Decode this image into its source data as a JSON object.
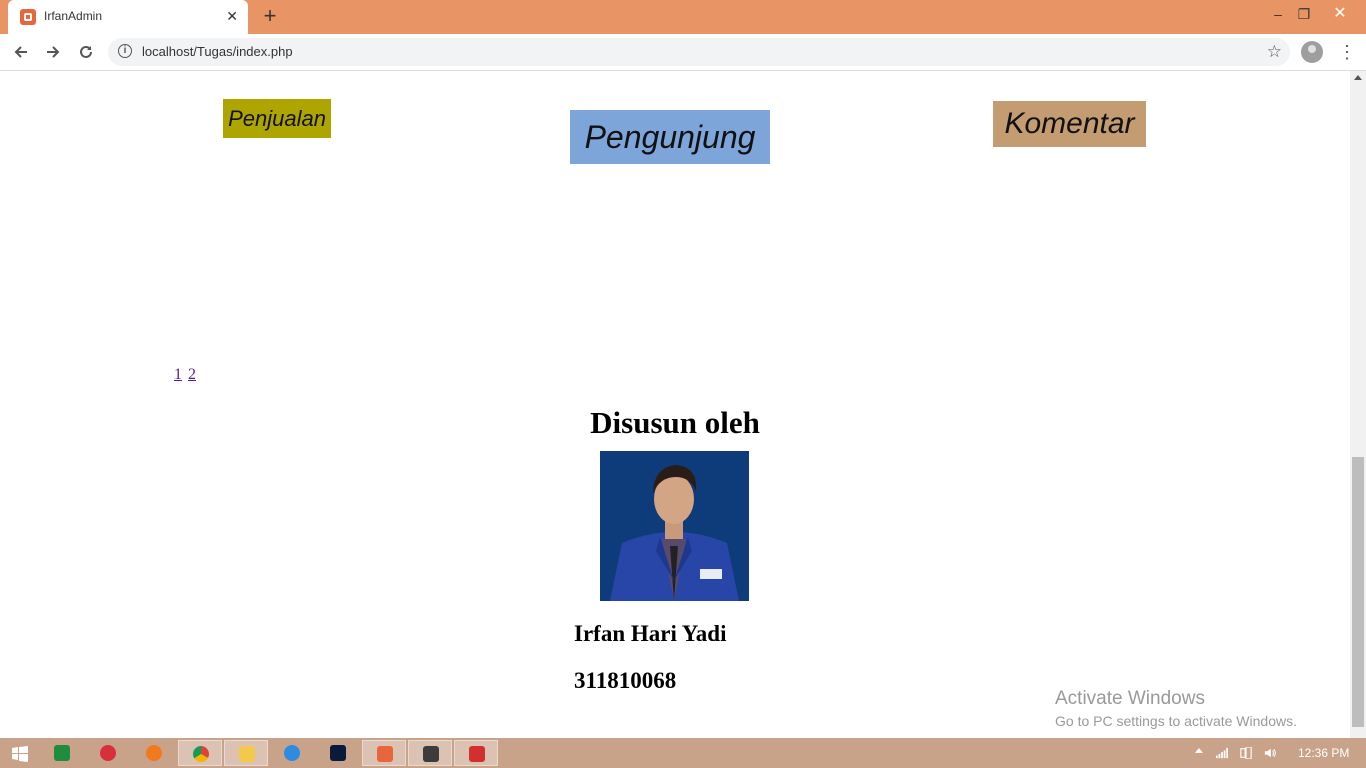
{
  "browser": {
    "tab_title": "IrfanAdmin",
    "url": "localhost/Tugas/index.php",
    "new_tab_symbol": "+",
    "close_tab_symbol": "✕"
  },
  "window_controls": {
    "minimize": "–",
    "maximize": "❐",
    "close": "✕"
  },
  "stats": {
    "penjualan": "Penjualan",
    "pengunjung": "Pengunjung",
    "komentar": "Komentar",
    "colors": {
      "penjualan": "#AFA500",
      "pengunjung": "#7DA5DA",
      "komentar": "#C49C72"
    }
  },
  "pagination": [
    "1",
    "2"
  ],
  "credit": {
    "heading": "Disusun oleh",
    "name": "Irfan Hari Yadi",
    "id": "311810068"
  },
  "watermark": {
    "line1": "Activate Windows",
    "line2": "Go to PC settings to activate Windows."
  },
  "taskbar": {
    "clock": "12:36 PM",
    "apps": [
      "start-icon",
      "spreadsheet-icon",
      "camera-icon",
      "firefox-icon",
      "chrome-icon",
      "file-explorer-icon",
      "browser-icon",
      "photoshop-icon",
      "xampp-icon",
      "sublime-icon",
      "acrobat-icon"
    ]
  }
}
